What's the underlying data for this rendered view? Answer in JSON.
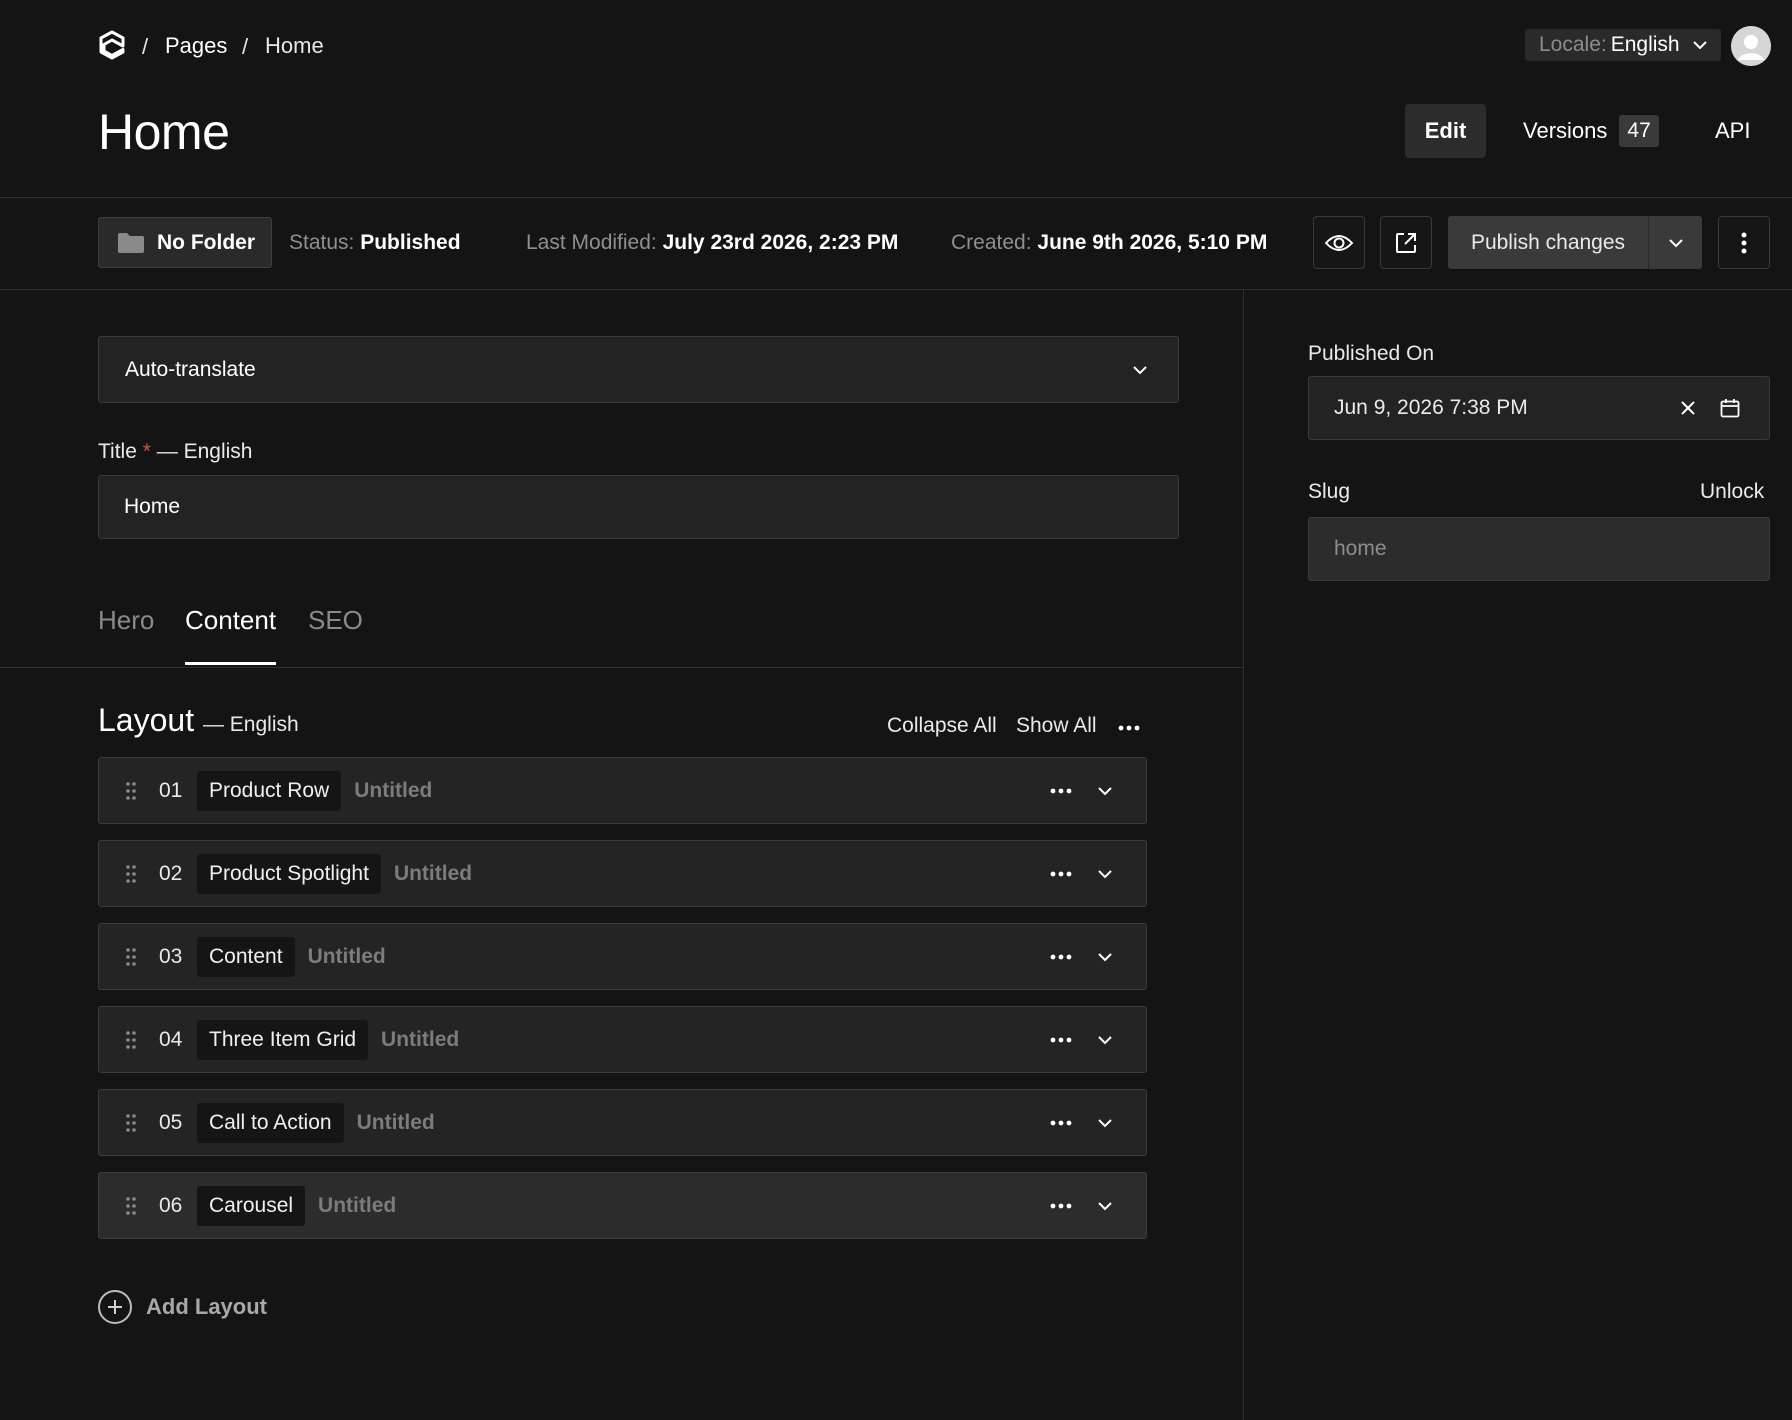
{
  "breadcrumb": {
    "separator": "/",
    "items": [
      "Pages",
      "Home"
    ]
  },
  "locale": {
    "label": "Locale:",
    "value": "English"
  },
  "page": {
    "title": "Home"
  },
  "view_tabs": {
    "edit": "Edit",
    "versions": "Versions",
    "versions_count": "47",
    "api": "API"
  },
  "meta": {
    "folder": "No Folder",
    "status_label": "Status:",
    "status_value": "Published",
    "modified_label": "Last Modified:",
    "modified_value": "July 23rd 2026, 2:23 PM",
    "created_label": "Created:",
    "created_value": "June 9th 2026, 5:10 PM"
  },
  "actions": {
    "publish": "Publish changes"
  },
  "auto_translate": {
    "label": "Auto-translate"
  },
  "title_field": {
    "label": "Title",
    "required_mark": "*",
    "locale_suffix": "— English",
    "value": "Home"
  },
  "content_tabs": [
    "Hero",
    "Content",
    "SEO"
  ],
  "active_tab": "Content",
  "layout": {
    "title": "Layout",
    "locale_suffix": "— English",
    "collapse_all": "Collapse All",
    "show_all": "Show All",
    "blocks": [
      {
        "num": "01",
        "type": "Product Row",
        "name": "Untitled"
      },
      {
        "num": "02",
        "type": "Product Spotlight",
        "name": "Untitled"
      },
      {
        "num": "03",
        "type": "Content",
        "name": "Untitled"
      },
      {
        "num": "04",
        "type": "Three Item Grid",
        "name": "Untitled"
      },
      {
        "num": "05",
        "type": "Call to Action",
        "name": "Untitled"
      },
      {
        "num": "06",
        "type": "Carousel",
        "name": "Untitled"
      }
    ],
    "add_label": "Add Layout"
  },
  "sidebar": {
    "published_on_label": "Published On",
    "published_on_value": "Jun 9, 2026 7:38 PM",
    "slug_label": "Slug",
    "unlock_label": "Unlock",
    "slug_value": "home"
  },
  "icons": [
    "logo-icon",
    "chevron-down-icon",
    "avatar",
    "folder-icon",
    "eye-icon",
    "external-link-icon",
    "kebab-icon",
    "drag-handle-icon",
    "ellipsis-icon",
    "plus-circle-icon",
    "close-icon",
    "calendar-icon"
  ]
}
